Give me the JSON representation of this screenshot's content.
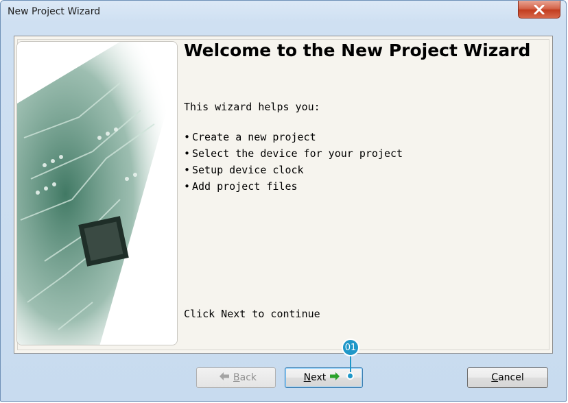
{
  "window": {
    "title": "New Project Wizard",
    "close_icon": "close-x-icon"
  },
  "main": {
    "heading": "Welcome to the New Project Wizard",
    "intro": "This wizard helps you:",
    "bullets": [
      "Create a new project",
      "Select the device for your project",
      "Setup device clock",
      "Add project files"
    ],
    "footer_text": "Click Next to continue",
    "side_image": "circuit-board-image"
  },
  "buttons": {
    "back_label": "Back",
    "back_mnemonic": "B",
    "back_rest": "ack",
    "back_icon": "arrow-left-icon",
    "next_label": "Next",
    "next_mnemonic": "N",
    "next_rest": "ext",
    "next_icon": "arrow-right-icon",
    "cancel_label": "Cancel",
    "cancel_mnemonic": "C",
    "cancel_rest": "ancel"
  },
  "annotation": {
    "callout_label": "01"
  },
  "colors": {
    "accent": "#1f97c8",
    "next_arrow": "#2aa12a",
    "close_red": "#c23d1f"
  }
}
